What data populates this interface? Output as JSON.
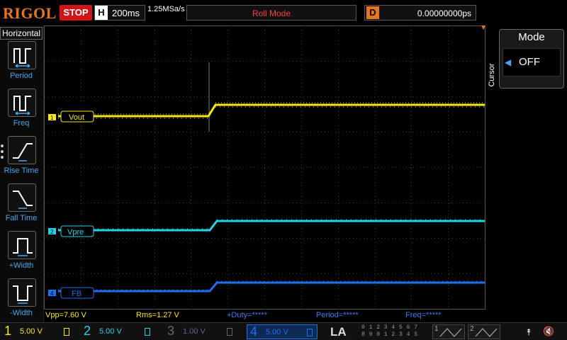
{
  "topbar": {
    "logo": "RIGOL",
    "run_state": "STOP",
    "horizontal_letter": "H",
    "timebase": "200ms",
    "sample_rate": "1.25MSa/s",
    "trigger_mode": "Roll Mode",
    "delay_letter": "D",
    "delay_value": "0.00000000ps"
  },
  "left_menu": {
    "title": "Horizontal",
    "items": [
      {
        "label": "Period",
        "icon": "period-icon"
      },
      {
        "label": "Freq",
        "icon": "freq-icon"
      },
      {
        "label": "Rise Time",
        "icon": "rise-time-icon"
      },
      {
        "label": "Fall Time",
        "icon": "fall-time-icon"
      },
      {
        "label": "+Width",
        "icon": "positive-width-icon"
      },
      {
        "label": "-Width",
        "icon": "negative-width-icon"
      }
    ]
  },
  "right_menu": {
    "section": "Cursor",
    "mode_title": "Mode",
    "mode_value": "OFF"
  },
  "traces": [
    {
      "channel": "1",
      "label": "Vout",
      "color": "#f4e81a"
    },
    {
      "channel": "2",
      "label": "Vpre",
      "color": "#22d3e6"
    },
    {
      "channel": "4",
      "label": "FB",
      "color": "#1e6ff0"
    }
  ],
  "measurements": {
    "vpp": "Vpp=7.60 V",
    "rms": "Rms=1.27 V",
    "duty": "+Duty=*****",
    "period": "Period=*****",
    "freq": "Freq=*****"
  },
  "channels": [
    {
      "num": "1",
      "scale": "5.00 V",
      "color": "#f4e81a"
    },
    {
      "num": "2",
      "scale": "5.00 V",
      "color": "#22d3e6"
    },
    {
      "num": "3",
      "scale": "1.00 V",
      "color": "#7a5a78"
    },
    {
      "num": "4",
      "scale": "5.00 V",
      "color": "#1e6ff0"
    }
  ],
  "logic_analyzer": {
    "label": "LA",
    "row1": "0 1 2 3  4 5 6 7",
    "row2": "8 9 0 1  2 3 4 5"
  },
  "math": {
    "slot1": "1",
    "slot2": "2"
  }
}
